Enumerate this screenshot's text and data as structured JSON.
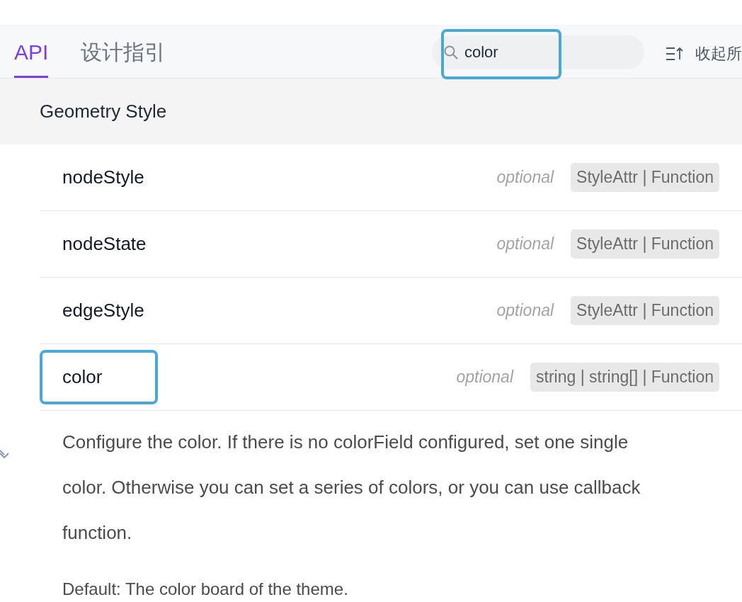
{
  "tabs": [
    {
      "label": "API",
      "selected": true
    },
    {
      "label": "设计指引",
      "selected": false
    }
  ],
  "search": {
    "value": "color",
    "highlighted": true
  },
  "collapse_button": {
    "label": "收起所"
  },
  "section": {
    "title": "Geometry Style"
  },
  "properties": [
    {
      "name": "nodeStyle",
      "optional": "optional",
      "type": "StyleAttr | Function",
      "highlighted": false
    },
    {
      "name": "nodeState",
      "optional": "optional",
      "type": "StyleAttr | Function",
      "highlighted": false
    },
    {
      "name": "edgeStyle",
      "optional": "optional",
      "type": "StyleAttr | Function",
      "highlighted": false
    },
    {
      "name": "color",
      "optional": "optional",
      "type": "string | string[] | Function",
      "highlighted": true,
      "description": "Configure the color. If there is no colorField configured, set one single color. Otherwise you can set a series of colors, or you can use callback function.",
      "default": "Default: The color board of the theme."
    }
  ]
}
